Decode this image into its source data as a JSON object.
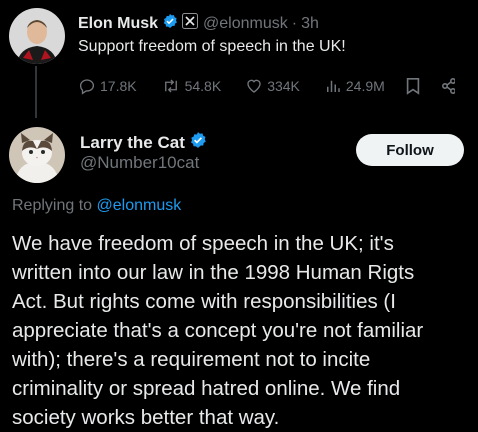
{
  "post1": {
    "author_name": "Elon Musk",
    "handle": "@elonmusk",
    "separator": "·",
    "time": "3h",
    "text": "Support freedom of speech in the UK!",
    "stats": {
      "replies": "17.8K",
      "reposts": "54.8K",
      "likes": "334K",
      "views": "24.9M"
    }
  },
  "post2": {
    "author_name": "Larry the Cat",
    "handle": "@Number10cat",
    "follow_label": "Follow",
    "replying_prefix": "Replying to",
    "replying_to": "@elonmusk",
    "body": "We have freedom of speech in the UK; it's\nwritten into our law in the 1998 Human Rigts\nAct. But rights come with responsibilities (I\nappreciate that's a concept you're not familiar\nwith); there's a requirement not to incite\ncriminality or spread hatred online. We find\nsociety works better that way."
  },
  "colors": {
    "background": "#000000",
    "text": "#e7e9ea",
    "muted": "#71767b",
    "link": "#1d9bf0",
    "verified": "#1d9bf0"
  }
}
